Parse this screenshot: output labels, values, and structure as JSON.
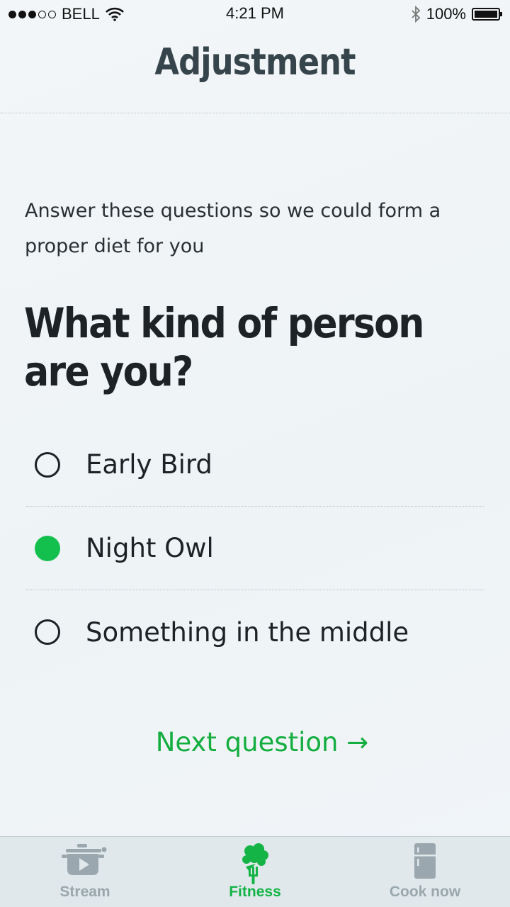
{
  "status_bar": {
    "carrier": "BELL",
    "time": "4:21 PM",
    "battery": "100%",
    "battery_level": 1.0
  },
  "header": {
    "title": "Adjustment"
  },
  "intro_text": "Answer these questions so we could form a proper diet for you",
  "question": "What kind of person are you?",
  "options": [
    {
      "label": "Early Bird",
      "selected": false
    },
    {
      "label": "Night Owl",
      "selected": true
    },
    {
      "label": "Something in the middle",
      "selected": false
    }
  ],
  "next_button": "Next question →",
  "tabs": [
    {
      "label": "Stream",
      "icon": "pot-play-icon",
      "active": false
    },
    {
      "label": "Fitness",
      "icon": "broccoli-fork-icon",
      "active": true
    },
    {
      "label": "Cook now",
      "icon": "fridge-icon",
      "active": false
    }
  ],
  "colors": {
    "accent_green": "#14c04d",
    "tab_inactive": "#9aa7ae",
    "title": "#36444b"
  }
}
